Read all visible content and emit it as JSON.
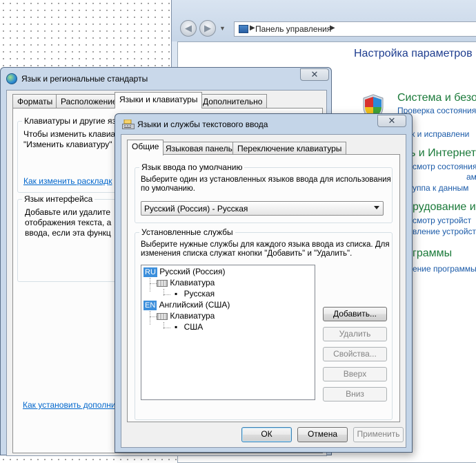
{
  "control_panel": {
    "address_path": "Панель управления",
    "title": "Настройка параметров к",
    "categories": [
      {
        "title": "Система и безоп",
        "links": [
          "Проверка состояния",
          "к и исправлени"
        ]
      },
      {
        "title": "ь и Интернет",
        "links": [
          "смотр состояния",
          "уппа к данным"
        ]
      },
      {
        "title": "рудование и",
        "links": [
          "смотр устройст",
          "вление устройст"
        ]
      },
      {
        "title": "граммы",
        "links": [
          "ение программы"
        ]
      }
    ],
    "extra_links": [
      "ам д"
    ]
  },
  "regional": {
    "title": "Язык и региональные стандарты",
    "tabs": [
      "Форматы",
      "Расположение",
      "Языки и клавиатуры",
      "Дополнительно"
    ],
    "active_tab": "Языки и клавиатуры",
    "keyboards_group": {
      "legend": "Клавиатуры и другие яз",
      "line1": "Чтобы изменить клавиа",
      "line2": "\"Изменить клавиатуру\"",
      "link": "Как изменить раскладк"
    },
    "interface_group": {
      "legend": "Язык интерфейса",
      "line1": "Добавьте или удалите",
      "line2": "отображения текста, а",
      "line3": "ввода, если эта функц"
    },
    "bottom_link": "Как установить дополнит"
  },
  "text_services": {
    "title": "Языки и службы текстового ввода",
    "tabs": [
      "Общие",
      "Языковая панель",
      "Переключение клавиатуры"
    ],
    "active_tab": "Общие",
    "default_group": {
      "legend": "Язык ввода по умолчанию",
      "desc_line1": "Выберите один из установленных языков ввода для использования",
      "desc_line2": "по умолчанию.",
      "selected": "Русский (Россия) - Русская"
    },
    "installed_group": {
      "legend": "Установленные службы",
      "desc_line1": "Выберите нужные службы для каждого языка ввода из списка. Для",
      "desc_line2": "изменения списка служат кнопки \"Добавить\" и \"Удалить\".",
      "tree": [
        {
          "badge": "RU",
          "language": "Русский (Россия)",
          "category": "Клавиатура",
          "layout": "Русская"
        },
        {
          "badge": "EN",
          "language": "Английский (США)",
          "category": "Клавиатура",
          "layout": "США"
        }
      ],
      "buttons": {
        "add": "Добавить...",
        "remove": "Удалить",
        "properties": "Свойства...",
        "up": "Вверх",
        "down": "Вниз"
      }
    },
    "footer": {
      "ok": "ОК",
      "cancel": "Отмена",
      "apply": "Применить"
    }
  }
}
